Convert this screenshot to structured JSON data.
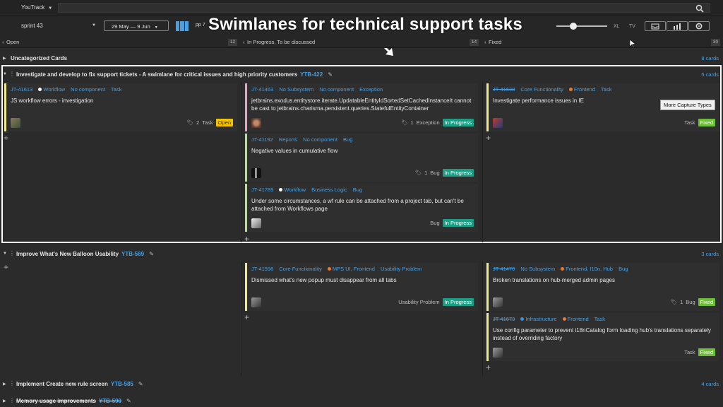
{
  "app": {
    "name": "YouTrack",
    "search_placeholder": ""
  },
  "toolbar": {
    "sprint": "sprint 43",
    "date_range": "29 May — 9 Jun",
    "partial_label": "pp 7",
    "size_xl": "XL",
    "size_tv": "TV",
    "card_size_level": 0.3
  },
  "overlay_caption": "Swimlanes for technical support tasks",
  "columns": [
    {
      "label": "Open",
      "count": "12"
    },
    {
      "label": "In Progress, To be discussed",
      "count": "14"
    },
    {
      "label": "Fixed",
      "count": "30"
    }
  ],
  "uncategorized": {
    "title": "Uncategorized Cards",
    "count": "8 cards"
  },
  "lanes": [
    {
      "title": "Investigate and develop to fix support tickets - A swimlane for critical issues and high priority customers",
      "issue": "YTB-422",
      "count": "5 cards"
    },
    {
      "title": "Improve What's New Balloon Usability",
      "issue": "YTB-569",
      "count": "3 cards"
    },
    {
      "title": "Implement Create new rule screen",
      "issue": "YTB-585",
      "count": "4 cards"
    },
    {
      "title": "Memory usage improvements",
      "issue": "YTB-590",
      "count": ""
    }
  ],
  "cards": [
    {
      "id": "JT-41613",
      "subsystem": "Workflow",
      "component": "No component",
      "type_tag": "Task",
      "summary": "JS workflow errors - investigation",
      "comments": "2",
      "type": "Task",
      "state": "Open"
    },
    {
      "id": "JT-41463",
      "subsystem": "No Subsystem",
      "component": "No component",
      "type_tag": "Exception",
      "summary": "jetbrains.exodus.entitystore.iterate.UpdatableEntityIdSortedSetCachedInstanceIt cannot be cast to jetbrains.charisma.persistent.queries.StatefulEntityContainer",
      "comments": "1",
      "type": "Exception",
      "state": "In Progress"
    },
    {
      "id": "JT-41192",
      "subsystem": "Reports",
      "component": "No component",
      "type_tag": "Bug",
      "summary": "Negative values in cumulative flow",
      "comments": "1",
      "type": "Bug",
      "state": "In Progress"
    },
    {
      "id": "JT-41789",
      "subsystem": "Workflow",
      "component": "Business Logic",
      "type_tag": "Bug",
      "summary": "Under some circumstances, a wf rule can be attached from a project tab, but can't be attached from Workflows page",
      "type": "Bug",
      "state": "In Progress"
    },
    {
      "id": "JT-41638",
      "subsystem": "Core Functionality",
      "component": "Frontend",
      "type_tag": "Task",
      "summary": "Investigate performance issues in IE",
      "type": "Task",
      "state": "Fixed"
    },
    {
      "id": "JT-41598",
      "subsystem": "Core Functionality",
      "component": "MPS UI, Frontend",
      "type_tag": "Usability Problem",
      "summary": "Dismissed what's new popup must disappear from all tabs",
      "type": "Usability Problem",
      "state": "In Progress"
    },
    {
      "id": "JT-41470",
      "subsystem": "No Subsystem",
      "component": "Frontend, I10n, Hub",
      "type_tag": "Bug",
      "summary": "Broken translations on hub-merged admin pages",
      "comments": "1",
      "type": "Bug",
      "state": "Fixed"
    },
    {
      "id": "JT-41673",
      "subsystem": "Infrastructure",
      "component": "Frontend",
      "type_tag": "Task",
      "summary": "Use config parameter to prevent i18nCatalog form loading hub's translations separately instead of overriding factory",
      "type": "Task",
      "state": "Fixed"
    }
  ],
  "tooltip": "More Capture Types",
  "colors": {
    "accent_blue": "#4a9fe0",
    "open_badge": "#f3c300",
    "in_progress_badge": "#18a086",
    "fixed_badge": "#6cbf33",
    "dot_white": "#ffffff",
    "dot_orange": "#e8792f",
    "dot_blue": "#3f8fe0"
  }
}
